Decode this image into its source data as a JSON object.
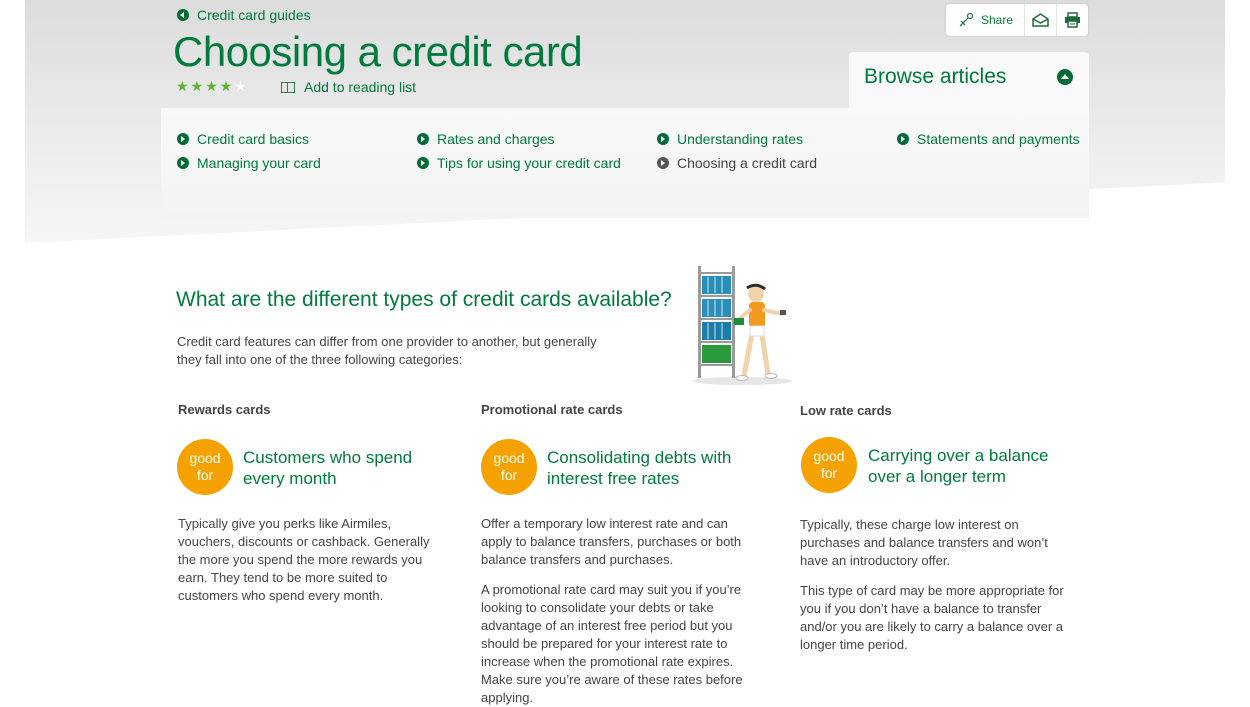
{
  "header": {
    "breadcrumb": "Credit card guides",
    "title": "Choosing a credit card",
    "rating": {
      "value": 4,
      "max": 5
    },
    "reading_list_label": "Add to reading list"
  },
  "toolbar": {
    "share_label": "Share",
    "icons": [
      "share-icon",
      "email-icon",
      "print-icon"
    ]
  },
  "browse": {
    "title": "Browse articles",
    "links": [
      {
        "label": "Credit card basics"
      },
      {
        "label": "Rates and charges"
      },
      {
        "label": "Understanding rates"
      },
      {
        "label": "Statements and payments"
      },
      {
        "label": "Managing your card"
      },
      {
        "label": "Tips for using your credit card"
      },
      {
        "label": "Choosing a credit card",
        "current": true
      }
    ]
  },
  "main": {
    "heading": "What are the different types of credit cards available?",
    "intro": "Credit card features can differ from one provider to another, but generally they fall into one of the three following categories:",
    "badge_line1": "good",
    "badge_line2": "for",
    "cards": [
      {
        "title": "Rewards cards",
        "good_for": "Customers who spend every month",
        "paragraphs": [
          "Typically give you perks like Airmiles, vouchers, discounts or cashback. Generally the more you spend the more rewards you earn. They tend to be more suited to customers who spend every month."
        ]
      },
      {
        "title": "Promotional rate cards",
        "good_for": "Consolidating debts with interest free rates",
        "paragraphs": [
          "Offer a temporary low interest rate and can apply to balance transfers, purchases or both balance transfers and purchases.",
          "A promotional rate card may suit you if you’re looking to consolidate your debts or take advantage of an interest free period but you should be prepared for your interest rate to increase when the promotional rate expires. Make sure you’re aware of these rates before applying."
        ]
      },
      {
        "title": "Low rate cards",
        "good_for": "Carrying over a balance over a longer term",
        "paragraphs": [
          "Typically, these charge low interest on purchases and balance transfers and won’t have an introductory offer.",
          "This type of card may be more appropriate for you if you don’t have a balance to transfer and/or you are likely to carry a balance over a longer time period."
        ]
      }
    ]
  },
  "colors": {
    "brand_green": "#007a3d",
    "badge_orange": "#f5a100",
    "star_green": "#5fb233"
  }
}
